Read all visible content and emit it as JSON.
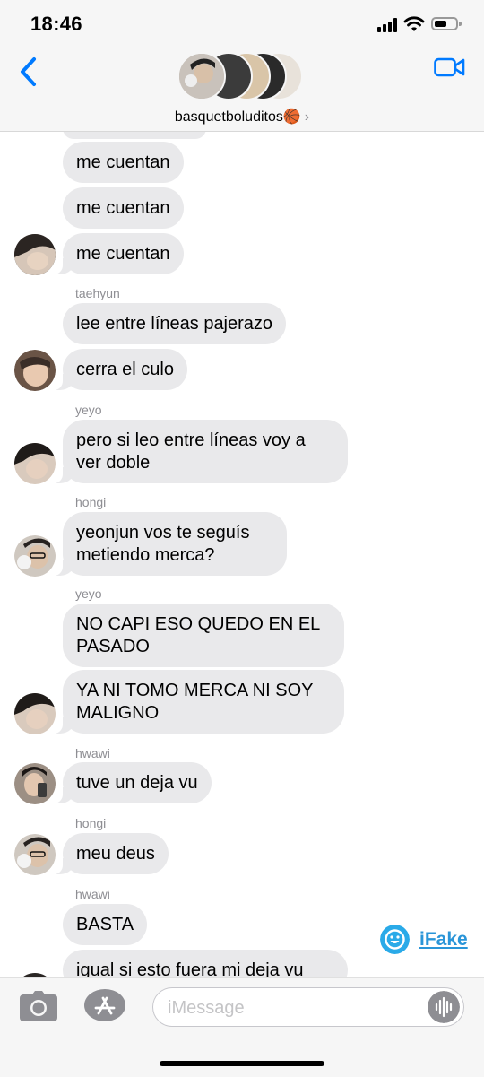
{
  "status": {
    "time": "18:46"
  },
  "header": {
    "group_name": "basquetboluditos🏀",
    "chevron": "›"
  },
  "messages": [
    {
      "sender": "",
      "text": "me cuentan"
    },
    {
      "sender": "",
      "text": "me cuentan"
    },
    {
      "sender": "",
      "text": "me cuentan"
    },
    {
      "sender": "taehyun",
      "text": "lee entre líneas pajerazo"
    },
    {
      "sender": "",
      "text": "cerra el culo"
    },
    {
      "sender": "yeyo",
      "text": "pero si leo entre líneas voy a ver doble"
    },
    {
      "sender": "hongi",
      "text": "yeonjun vos te seguís metiendo merca?"
    },
    {
      "sender": "yeyo",
      "text": "NO CAPI ESO QUEDO EN EL PASADO"
    },
    {
      "sender": "",
      "text": "YA NI TOMO MERCA NI SOY MALIGNO"
    },
    {
      "sender": "hwawi",
      "text": "tuve un deja vu"
    },
    {
      "sender": "hongi",
      "text": "meu deus"
    },
    {
      "sender": "hwawi",
      "text": "BASTA"
    },
    {
      "sender": "",
      "text": "igual si esto fuera mi deja vu"
    }
  ],
  "watermark": {
    "label": "iFake"
  },
  "composer": {
    "placeholder": "iMessage"
  },
  "colors": {
    "accent": "#007aff",
    "bubble": "#e9e9eb",
    "meta": "#8e8e93"
  }
}
